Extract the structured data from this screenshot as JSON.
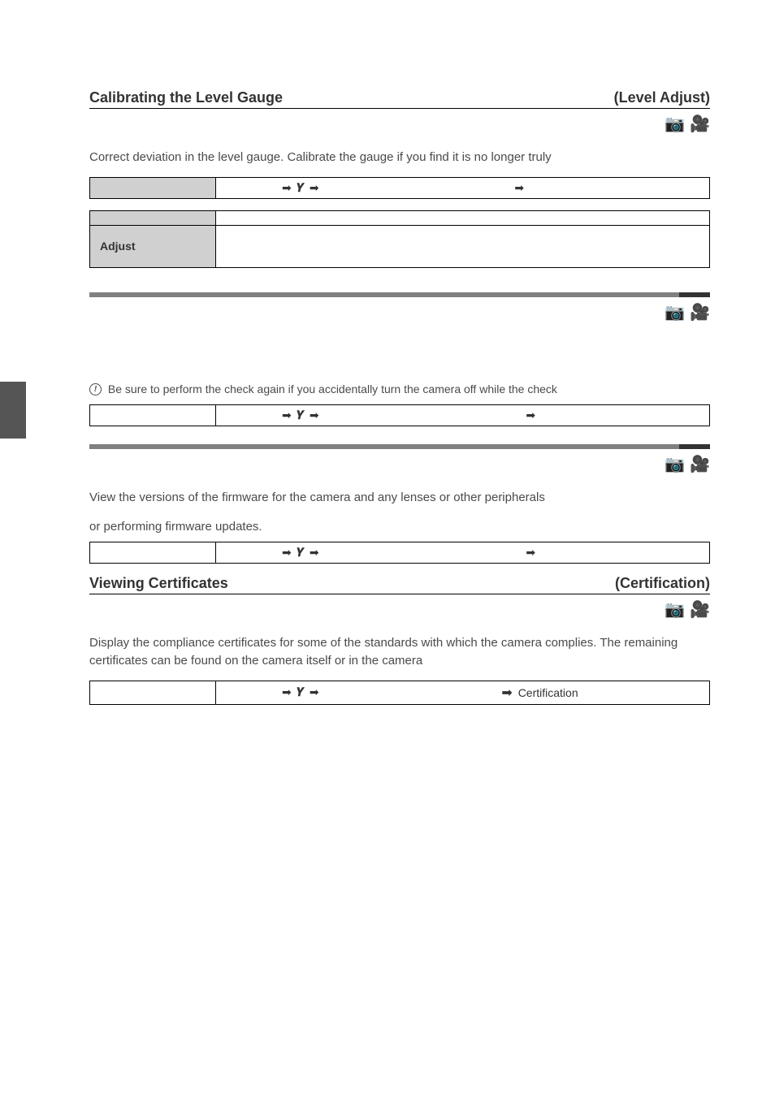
{
  "section1": {
    "title_left": "Calibrating the Level Gauge",
    "title_right": "(Level Adjust)",
    "mode_icon": "🎥",
    "body": "Correct deviation in the level gauge. Calibrate the gauge if you find it is no longer truly",
    "table_option_label": "Adjust"
  },
  "section2": {
    "mode_icon": "🎥",
    "info_text": "Be sure to perform the check again if you accidentally turn the camera off while the check"
  },
  "section3": {
    "mode_icon": "🎥",
    "body_line1": "View the versions of the firmware for the camera and any lenses or other peripherals",
    "body_line2": "or performing firmware updates."
  },
  "section4": {
    "title_left": "Viewing Certificates",
    "title_right": "(Certification)",
    "mode_icon": "🎥",
    "body": "Display the compliance certificates for some of the standards with which the camera complies. The remaining certificates can be found on the camera itself or in the camera",
    "nav_end": "Certification"
  },
  "nav": {
    "arrow": "➡",
    "wrench": "🔧"
  }
}
